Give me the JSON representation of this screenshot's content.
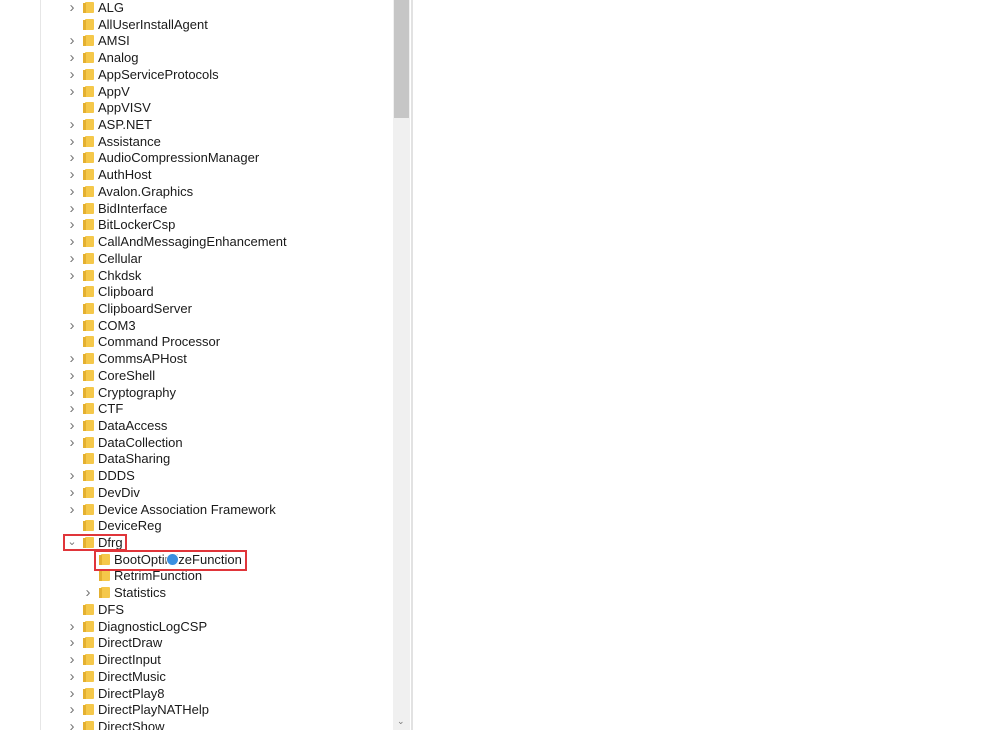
{
  "tree": [
    {
      "label": "ALG",
      "exp": "collapsed",
      "level": 0
    },
    {
      "label": "AllUserInstallAgent",
      "exp": "none",
      "level": 0
    },
    {
      "label": "AMSI",
      "exp": "collapsed",
      "level": 0
    },
    {
      "label": "Analog",
      "exp": "collapsed",
      "level": 0
    },
    {
      "label": "AppServiceProtocols",
      "exp": "collapsed",
      "level": 0
    },
    {
      "label": "AppV",
      "exp": "collapsed",
      "level": 0
    },
    {
      "label": "AppVISV",
      "exp": "none",
      "level": 0
    },
    {
      "label": "ASP.NET",
      "exp": "collapsed",
      "level": 0
    },
    {
      "label": "Assistance",
      "exp": "collapsed",
      "level": 0
    },
    {
      "label": "AudioCompressionManager",
      "exp": "collapsed",
      "level": 0
    },
    {
      "label": "AuthHost",
      "exp": "collapsed",
      "level": 0
    },
    {
      "label": "Avalon.Graphics",
      "exp": "collapsed",
      "level": 0
    },
    {
      "label": "BidInterface",
      "exp": "collapsed",
      "level": 0
    },
    {
      "label": "BitLockerCsp",
      "exp": "collapsed",
      "level": 0
    },
    {
      "label": "CallAndMessagingEnhancement",
      "exp": "collapsed",
      "level": 0
    },
    {
      "label": "Cellular",
      "exp": "collapsed",
      "level": 0
    },
    {
      "label": "Chkdsk",
      "exp": "collapsed",
      "level": 0
    },
    {
      "label": "Clipboard",
      "exp": "none",
      "level": 0
    },
    {
      "label": "ClipboardServer",
      "exp": "none",
      "level": 0
    },
    {
      "label": "COM3",
      "exp": "collapsed",
      "level": 0
    },
    {
      "label": "Command Processor",
      "exp": "none",
      "level": 0
    },
    {
      "label": "CommsAPHost",
      "exp": "collapsed",
      "level": 0
    },
    {
      "label": "CoreShell",
      "exp": "collapsed",
      "level": 0
    },
    {
      "label": "Cryptography",
      "exp": "collapsed",
      "level": 0
    },
    {
      "label": "CTF",
      "exp": "collapsed",
      "level": 0
    },
    {
      "label": "DataAccess",
      "exp": "collapsed",
      "level": 0
    },
    {
      "label": "DataCollection",
      "exp": "collapsed",
      "level": 0
    },
    {
      "label": "DataSharing",
      "exp": "none",
      "level": 0
    },
    {
      "label": "DDDS",
      "exp": "collapsed",
      "level": 0
    },
    {
      "label": "DevDiv",
      "exp": "collapsed",
      "level": 0
    },
    {
      "label": "Device Association Framework",
      "exp": "collapsed",
      "level": 0
    },
    {
      "label": "DeviceReg",
      "exp": "none",
      "level": 0
    },
    {
      "label": "Dfrg",
      "exp": "expanded",
      "level": 0
    },
    {
      "label": "BootOptimizeFunction",
      "exp": "none",
      "level": 1
    },
    {
      "label": "RetrimFunction",
      "exp": "none",
      "level": 1
    },
    {
      "label": "Statistics",
      "exp": "collapsed",
      "level": 1
    },
    {
      "label": "DFS",
      "exp": "none",
      "level": 0
    },
    {
      "label": "DiagnosticLogCSP",
      "exp": "collapsed",
      "level": 0
    },
    {
      "label": "DirectDraw",
      "exp": "collapsed",
      "level": 0
    },
    {
      "label": "DirectInput",
      "exp": "collapsed",
      "level": 0
    },
    {
      "label": "DirectMusic",
      "exp": "collapsed",
      "level": 0
    },
    {
      "label": "DirectPlay8",
      "exp": "collapsed",
      "level": 0
    },
    {
      "label": "DirectPlayNATHelp",
      "exp": "collapsed",
      "level": 0
    },
    {
      "label": "DirectShow",
      "exp": "collapsed",
      "level": 0
    }
  ],
  "highlight_color": "#e0353a",
  "folder_color": "#f5c84a"
}
